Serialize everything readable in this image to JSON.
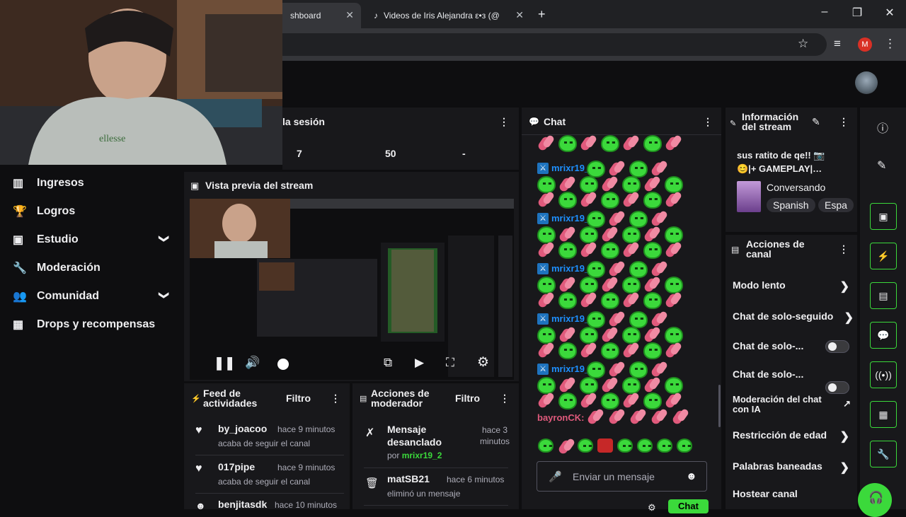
{
  "browser": {
    "tabs": [
      {
        "label": "shboard",
        "close": "✕"
      },
      {
        "label": "Videos de Iris Alejandra ε•з (@",
        "close": "✕"
      }
    ],
    "new_tab": "+",
    "window_controls": {
      "minimize": "–",
      "restore": "❐",
      "close": "✕"
    },
    "profile_letter": "M"
  },
  "sidebar": {
    "items": [
      {
        "label": "Ingresos",
        "icon": "chart-icon"
      },
      {
        "label": "Logros",
        "icon": "trophy-icon"
      },
      {
        "label": "Estudio",
        "icon": "studio-icon",
        "chevron": "❯"
      },
      {
        "label": "Moderación",
        "icon": "wrench-icon"
      },
      {
        "label": "Comunidad",
        "icon": "community-icon",
        "chevron": "❯"
      },
      {
        "label": "Drops y recompensas",
        "icon": "gift-icon"
      }
    ]
  },
  "session": {
    "title": "la sesión",
    "stats": [
      "7",
      "50",
      "-"
    ]
  },
  "preview": {
    "title": "Vista previa del stream"
  },
  "feed": {
    "title_line1": "Feed de",
    "title_line2": "actividades",
    "filter": "Filtro",
    "items": [
      {
        "name": "by_joacoo",
        "time": "hace 9 minutos",
        "sub": "acaba de seguir el canal"
      },
      {
        "name": "017pipe",
        "time": "hace 9 minutos",
        "sub": "acaba de seguir el canal"
      },
      {
        "name": "benjitasdk",
        "time": "hace 10 minutos",
        "sub": ""
      }
    ]
  },
  "modactions": {
    "title_line1": "Acciones de",
    "title_line2": "moderador",
    "filter": "Filtro",
    "items": [
      {
        "title_line1": "Mensaje",
        "title_line2": "desanclado",
        "time_line1": "hace 3",
        "time_line2": "minutos",
        "by_prefix": "por",
        "by": "mrixr19_2"
      },
      {
        "title_line1": "matSB21",
        "time_line1": "hace 6 minutos",
        "sub": "eliminó un mensaje"
      }
    ]
  },
  "chat": {
    "title": "Chat",
    "user": "mrixr19_2:",
    "last_user": "bayronCK:",
    "input_placeholder": "Enviar un mensaje",
    "send": "Chat"
  },
  "stream_info": {
    "title_line1": "Información",
    "title_line2": "del stream",
    "stream_title_line1": "sus ratito de qe!! 📷",
    "stream_title_line2": "😊|+ GAMEPLAY|…",
    "category": "Conversando",
    "tags": [
      "Spanish",
      "Espa"
    ]
  },
  "channel_actions": {
    "title_line1": "Acciones de",
    "title_line2": "canal",
    "items": [
      {
        "label": "Modo lento",
        "control": "arrow"
      },
      {
        "label": "Chat de solo-seguido",
        "control": "arrow"
      },
      {
        "label": "Chat de solo-...",
        "control": "toggle",
        "enabled": false
      },
      {
        "label": "Chat de solo-...",
        "control": "toggle",
        "enabled": false
      },
      {
        "label_line1": "Moderación del chat",
        "label_line2": "con IA",
        "control": "external"
      },
      {
        "label": "Restricción de edad",
        "control": "arrow"
      },
      {
        "label": "Palabras baneadas",
        "control": "arrow"
      },
      {
        "label": "Hostear canal",
        "control": "none"
      }
    ]
  },
  "colors": {
    "accent_green": "#3bd93b",
    "chat_user_blue": "#1e90ff",
    "last_user_pink": "#e05a7c",
    "link_green": "#3bd93b"
  }
}
